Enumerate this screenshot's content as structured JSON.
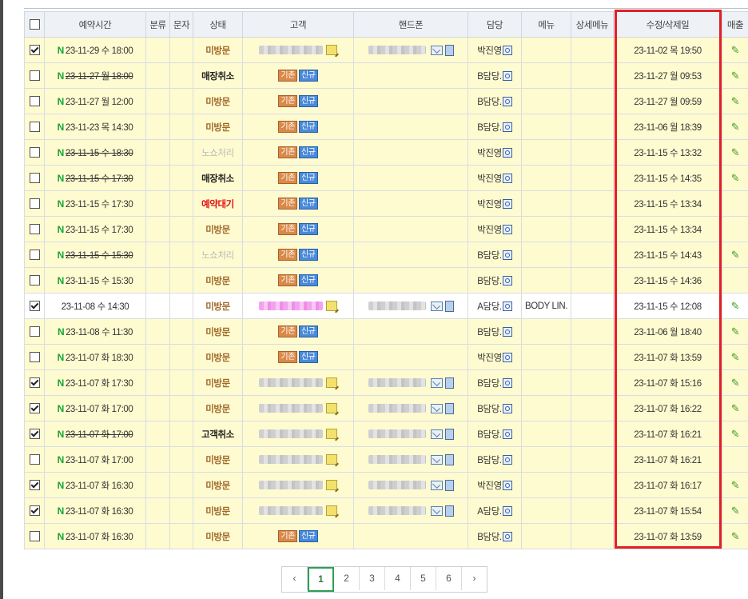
{
  "headers": [
    "",
    "예약시간",
    "분류",
    "문자",
    "상태",
    "고객",
    "핸드폰",
    "담당",
    "메뉴",
    "상세메뉴",
    "수정/삭제일",
    "매출"
  ],
  "rows": [
    {
      "checked": true,
      "n": true,
      "time": "23-11-29 수  18:00",
      "strike": false,
      "status": "미방문",
      "statusClass": "st-brown",
      "customer": "blur",
      "phone": true,
      "staff": "박진영",
      "menu": "",
      "modified": "23-11-02 목  19:50",
      "sales": true,
      "bg": "yel"
    },
    {
      "checked": false,
      "n": true,
      "time": "23-11-27 월  18:00",
      "strike": true,
      "status": "매장취소",
      "statusClass": "st-black",
      "customer": "badges",
      "phone": false,
      "staff": "B담당.",
      "menu": "",
      "modified": "23-11-27 월  09:53",
      "sales": true,
      "bg": "yel"
    },
    {
      "checked": false,
      "n": true,
      "time": "23-11-27 월  12:00",
      "strike": false,
      "status": "미방문",
      "statusClass": "st-brown",
      "customer": "badges",
      "phone": false,
      "staff": "B담당.",
      "menu": "",
      "modified": "23-11-27 월  09:59",
      "sales": true,
      "bg": "yel"
    },
    {
      "checked": false,
      "n": true,
      "time": "23-11-23 목  14:30",
      "strike": false,
      "status": "미방문",
      "statusClass": "st-brown",
      "customer": "badges",
      "phone": false,
      "staff": "B담당.",
      "menu": "",
      "modified": "23-11-06 월  18:39",
      "sales": true,
      "bg": "yel"
    },
    {
      "checked": false,
      "n": true,
      "time": "23-11-15 수  18:30",
      "strike": true,
      "status": "노쇼처리",
      "statusClass": "st-gray",
      "customer": "badges",
      "phone": false,
      "staff": "박진영",
      "menu": "",
      "modified": "23-11-15 수  13:32",
      "sales": true,
      "bg": "yel"
    },
    {
      "checked": false,
      "n": true,
      "time": "23-11-15 수  17:30",
      "strike": true,
      "status": "매장취소",
      "statusClass": "st-black",
      "customer": "badges",
      "phone": false,
      "staff": "박진영",
      "menu": "",
      "modified": "23-11-15 수  14:35",
      "sales": true,
      "bg": "yel"
    },
    {
      "checked": false,
      "n": true,
      "time": "23-11-15 수  17:30",
      "strike": false,
      "status": "예약대기",
      "statusClass": "st-red",
      "customer": "badges",
      "phone": false,
      "staff": "박진영",
      "menu": "",
      "modified": "23-11-15 수  13:34",
      "sales": false,
      "bg": "yel"
    },
    {
      "checked": false,
      "n": true,
      "time": "23-11-15 수  17:30",
      "strike": false,
      "status": "미방문",
      "statusClass": "st-brown",
      "customer": "badges",
      "phone": false,
      "staff": "박진영",
      "menu": "",
      "modified": "23-11-15 수  13:34",
      "sales": false,
      "bg": "yel"
    },
    {
      "checked": false,
      "n": true,
      "time": "23-11-15 수  15:30",
      "strike": true,
      "status": "노쇼처리",
      "statusClass": "st-gray",
      "customer": "badges",
      "phone": false,
      "staff": "B담당.",
      "menu": "",
      "modified": "23-11-15 수  14:43",
      "sales": true,
      "bg": "yel"
    },
    {
      "checked": false,
      "n": true,
      "time": "23-11-15 수  15:30",
      "strike": false,
      "status": "미방문",
      "statusClass": "st-brown",
      "customer": "badges",
      "phone": false,
      "staff": "B담당.",
      "menu": "",
      "modified": "23-11-15 수  14:36",
      "sales": false,
      "bg": "yel"
    },
    {
      "checked": true,
      "n": false,
      "time": "23-11-08 수  14:30",
      "strike": false,
      "status": "미방문",
      "statusClass": "st-brown",
      "customer": "pink",
      "phone": true,
      "staff": "A담당.",
      "menu": "BODY LIN.",
      "modified": "23-11-15 수  12:08",
      "sales": true,
      "bg": "wht"
    },
    {
      "checked": false,
      "n": true,
      "time": "23-11-08 수  11:30",
      "strike": false,
      "status": "미방문",
      "statusClass": "st-brown",
      "customer": "badges",
      "phone": false,
      "staff": "B담당.",
      "menu": "",
      "modified": "23-11-06 월  18:40",
      "sales": true,
      "bg": "yel"
    },
    {
      "checked": false,
      "n": true,
      "time": "23-11-07 화  18:30",
      "strike": false,
      "status": "미방문",
      "statusClass": "st-brown",
      "customer": "badges",
      "phone": false,
      "staff": "박진영",
      "menu": "",
      "modified": "23-11-07 화  13:59",
      "sales": true,
      "bg": "yel"
    },
    {
      "checked": true,
      "n": true,
      "time": "23-11-07 화  17:30",
      "strike": false,
      "status": "미방문",
      "statusClass": "st-brown",
      "customer": "blur",
      "phone": true,
      "staff": "B담당.",
      "menu": "",
      "modified": "23-11-07 화  15:16",
      "sales": true,
      "bg": "yel"
    },
    {
      "checked": true,
      "n": true,
      "time": "23-11-07 화  17:00",
      "strike": false,
      "status": "미방문",
      "statusClass": "st-brown",
      "customer": "blur",
      "phone": true,
      "staff": "B담당.",
      "menu": "",
      "modified": "23-11-07 화  16:22",
      "sales": true,
      "bg": "yel"
    },
    {
      "checked": true,
      "n": true,
      "time": "23-11-07 화  17:00",
      "strike": true,
      "status": "고객취소",
      "statusClass": "st-black",
      "customer": "blur",
      "phone": true,
      "staff": "B담당.",
      "menu": "",
      "modified": "23-11-07 화  16:21",
      "sales": true,
      "bg": "yel"
    },
    {
      "checked": false,
      "n": true,
      "time": "23-11-07 화  17:00",
      "strike": false,
      "status": "미방문",
      "statusClass": "st-brown",
      "customer": "blur",
      "phone": true,
      "staff": "B담당.",
      "menu": "",
      "modified": "23-11-07 화  16:21",
      "sales": false,
      "bg": "yel"
    },
    {
      "checked": true,
      "n": true,
      "time": "23-11-07 화  16:30",
      "strike": false,
      "status": "미방문",
      "statusClass": "st-brown",
      "customer": "blur",
      "phone": true,
      "staff": "박진영",
      "menu": "",
      "modified": "23-11-07 화  16:17",
      "sales": true,
      "bg": "yel"
    },
    {
      "checked": true,
      "n": true,
      "time": "23-11-07 화  16:30",
      "strike": false,
      "status": "미방문",
      "statusClass": "st-brown",
      "customer": "blur",
      "phone": true,
      "staff": "A담당.",
      "menu": "",
      "modified": "23-11-07 화  15:54",
      "sales": true,
      "bg": "yel"
    },
    {
      "checked": false,
      "n": true,
      "time": "23-11-07 화  16:30",
      "strike": false,
      "status": "미방문",
      "statusClass": "st-brown",
      "customer": "badges",
      "phone": false,
      "staff": "B담당.",
      "menu": "",
      "modified": "23-11-07 화  13:59",
      "sales": true,
      "bg": "yel"
    }
  ],
  "badges": {
    "existing": "기존",
    "new": "신규"
  },
  "pagination": {
    "prev": "‹",
    "pages": [
      "1",
      "2",
      "3",
      "4",
      "5",
      "6"
    ],
    "next": "›",
    "active": "1"
  },
  "icons": {
    "pencil": "✎"
  },
  "colors": {
    "highlight": "#e21f26",
    "row_bg": "#fffbd0",
    "n_mark": "#19a33a"
  }
}
